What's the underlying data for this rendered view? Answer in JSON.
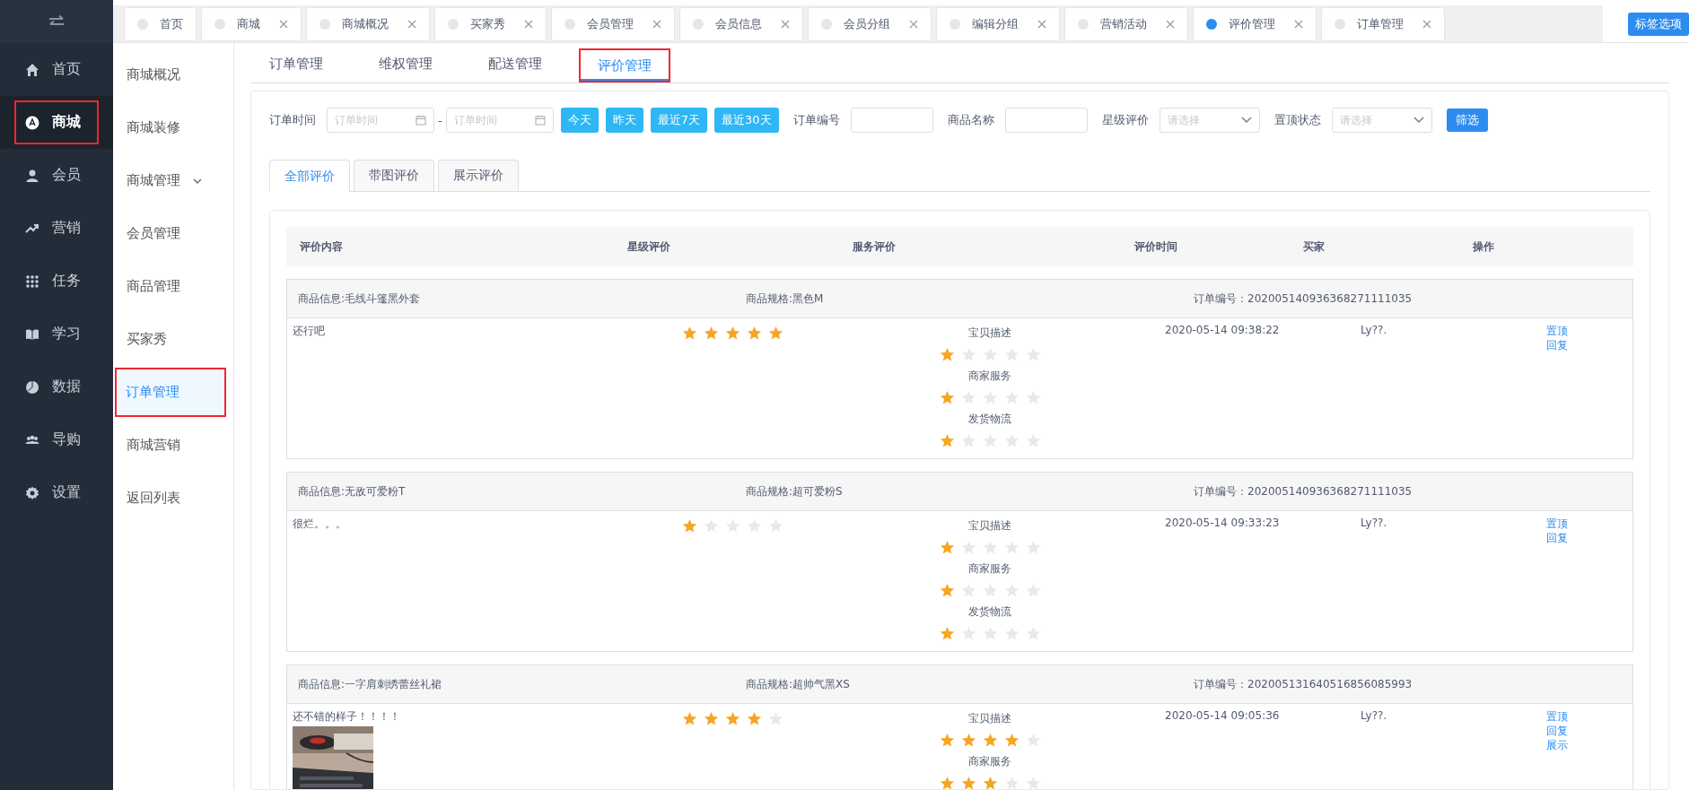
{
  "sidebar": {
    "items": [
      {
        "label": "首页",
        "selected": false,
        "annotated": false
      },
      {
        "label": "商城",
        "selected": true,
        "annotated": true
      },
      {
        "label": "会员",
        "selected": false,
        "annotated": false
      },
      {
        "label": "营销",
        "selected": false,
        "annotated": false
      },
      {
        "label": "任务",
        "selected": false,
        "annotated": false
      },
      {
        "label": "学习",
        "selected": false,
        "annotated": false
      },
      {
        "label": "数据",
        "selected": false,
        "annotated": false
      },
      {
        "label": "导购",
        "selected": false,
        "annotated": false
      },
      {
        "label": "设置",
        "selected": false,
        "annotated": false
      }
    ]
  },
  "submenu": {
    "items": [
      {
        "label": "商城概况",
        "selected": false,
        "annotated": false,
        "expandable": false
      },
      {
        "label": "商城装修",
        "selected": false,
        "annotated": false,
        "expandable": false
      },
      {
        "label": "商城管理",
        "selected": false,
        "annotated": false,
        "expandable": true
      },
      {
        "label": "会员管理",
        "selected": false,
        "annotated": false,
        "expandable": false
      },
      {
        "label": "商品管理",
        "selected": false,
        "annotated": false,
        "expandable": false
      },
      {
        "label": "买家秀",
        "selected": false,
        "annotated": false,
        "expandable": false
      },
      {
        "label": "订单管理",
        "selected": true,
        "annotated": true,
        "expandable": false
      },
      {
        "label": "商城营销",
        "selected": false,
        "annotated": false,
        "expandable": false
      },
      {
        "label": "返回列表",
        "selected": false,
        "annotated": false,
        "expandable": false
      }
    ]
  },
  "open_tabs": [
    {
      "label": "首页",
      "selected": false,
      "closable": false
    },
    {
      "label": "商城",
      "selected": false,
      "closable": true
    },
    {
      "label": "商城概况",
      "selected": false,
      "closable": true
    },
    {
      "label": "买家秀",
      "selected": false,
      "closable": true
    },
    {
      "label": "会员管理",
      "selected": false,
      "closable": true
    },
    {
      "label": "会员信息",
      "selected": false,
      "closable": true
    },
    {
      "label": "会员分组",
      "selected": false,
      "closable": true
    },
    {
      "label": "编辑分组",
      "selected": false,
      "closable": true
    },
    {
      "label": "营销活动",
      "selected": false,
      "closable": true
    },
    {
      "label": "评价管理",
      "selected": true,
      "closable": true
    },
    {
      "label": "订单管理",
      "selected": false,
      "closable": true
    }
  ],
  "tab_options_button": "标签选项",
  "page_tabs": [
    {
      "label": "订单管理",
      "selected": false,
      "annotated": false
    },
    {
      "label": "维权管理",
      "selected": false,
      "annotated": false
    },
    {
      "label": "配送管理",
      "selected": false,
      "annotated": false
    },
    {
      "label": "评价管理",
      "selected": true,
      "annotated": true
    }
  ],
  "filters": {
    "order_time": {
      "label": "订单时间",
      "start_placeholder": "订单时间",
      "separator": "-",
      "end_placeholder": "订单时间"
    },
    "quick_ranges": [
      "今天",
      "昨天",
      "最近7天",
      "最近30天"
    ],
    "fields": [
      {
        "kind": "text",
        "label": "订单编号"
      },
      {
        "kind": "text",
        "label": "商品名称"
      },
      {
        "kind": "select",
        "label": "星级评价",
        "placeholder": "请选择"
      },
      {
        "kind": "select",
        "label": "置顶状态",
        "placeholder": "请选择"
      }
    ],
    "submit": "筛选"
  },
  "review_tabs": [
    {
      "label": "全部评价",
      "selected": true
    },
    {
      "label": "带图评价",
      "selected": false
    },
    {
      "label": "展示评价",
      "selected": false
    }
  ],
  "table": {
    "columns": [
      "评价内容",
      "星级评价",
      "服务评价",
      "评价时间",
      "买家",
      "操作"
    ],
    "rows": [
      {
        "product_info": "商品信息:毛线斗篷黑外套",
        "spec": "商品规格:黑色M",
        "order_no": "订单编号：202005140936368271111035",
        "content": "还行吧",
        "stars": 5,
        "service": [
          {
            "label": "宝贝描述",
            "stars": 1
          },
          {
            "label": "商家服务",
            "stars": 1
          },
          {
            "label": "发货物流",
            "stars": 1
          }
        ],
        "time": "2020-05-14 09:38:22",
        "buyer": "Ly??.",
        "actions": [
          "置顶",
          "回复"
        ]
      },
      {
        "product_info": "商品信息:无敌可爱粉T",
        "spec": "商品规格:超可爱粉S",
        "order_no": "订单编号：202005140936368271111035",
        "content": "很烂。。。",
        "stars": 1,
        "service": [
          {
            "label": "宝贝描述",
            "stars": 1
          },
          {
            "label": "商家服务",
            "stars": 1
          },
          {
            "label": "发货物流",
            "stars": 1
          }
        ],
        "time": "2020-05-14 09:33:23",
        "buyer": "Ly??.",
        "actions": [
          "置顶",
          "回复"
        ]
      },
      {
        "product_info": "商品信息:一字肩刺绣蕾丝礼裙",
        "spec": "商品规格:超帅气黑XS",
        "order_no": "订单编号：202005131640516856085993",
        "content": "还不错的样子！！！！",
        "stars": 4,
        "images": [
          {
            "kind": "picture"
          }
        ],
        "service": [
          {
            "label": "宝贝描述",
            "stars": 4
          },
          {
            "label": "商家服务",
            "stars": 3
          }
        ],
        "time": "2020-05-14 09:05:36",
        "buyer": "Ly??.",
        "actions": [
          "置顶",
          "回复",
          "展示"
        ]
      }
    ]
  }
}
